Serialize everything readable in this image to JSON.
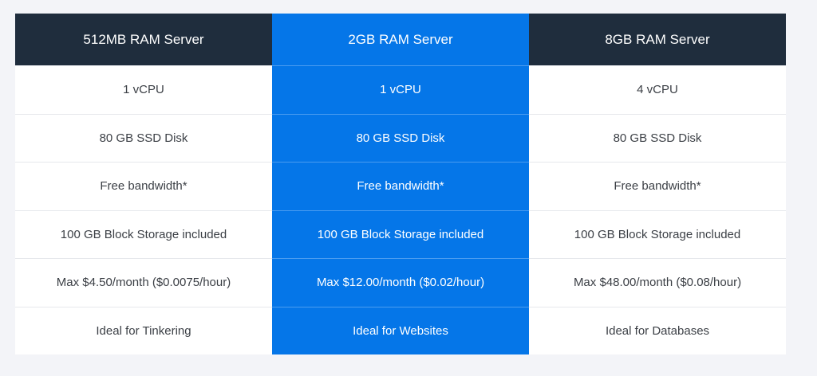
{
  "colors": {
    "page_background": "#f3f4f8",
    "header_dark": "#1f2d3d",
    "featured_blue": "#0576e8",
    "row_background": "#ffffff",
    "text_dark": "#3b3f45",
    "text_light": "#ffffff"
  },
  "plans": [
    {
      "title": "512MB RAM Server",
      "featured": false,
      "features": [
        "1 vCPU",
        "80 GB SSD Disk",
        "Free bandwidth*",
        "100 GB Block Storage included",
        "Max $4.50/month ($0.0075/hour)",
        "Ideal for Tinkering"
      ]
    },
    {
      "title": "2GB RAM Server",
      "featured": true,
      "features": [
        "1 vCPU",
        "80 GB SSD Disk",
        "Free bandwidth*",
        "100 GB Block Storage included",
        "Max $12.00/month ($0.02/hour)",
        "Ideal for Websites"
      ]
    },
    {
      "title": "8GB RAM Server",
      "featured": false,
      "features": [
        "4 vCPU",
        "80 GB SSD Disk",
        "Free bandwidth*",
        "100 GB Block Storage included",
        "Max $48.00/month ($0.08/hour)",
        "Ideal for Databases"
      ]
    }
  ]
}
